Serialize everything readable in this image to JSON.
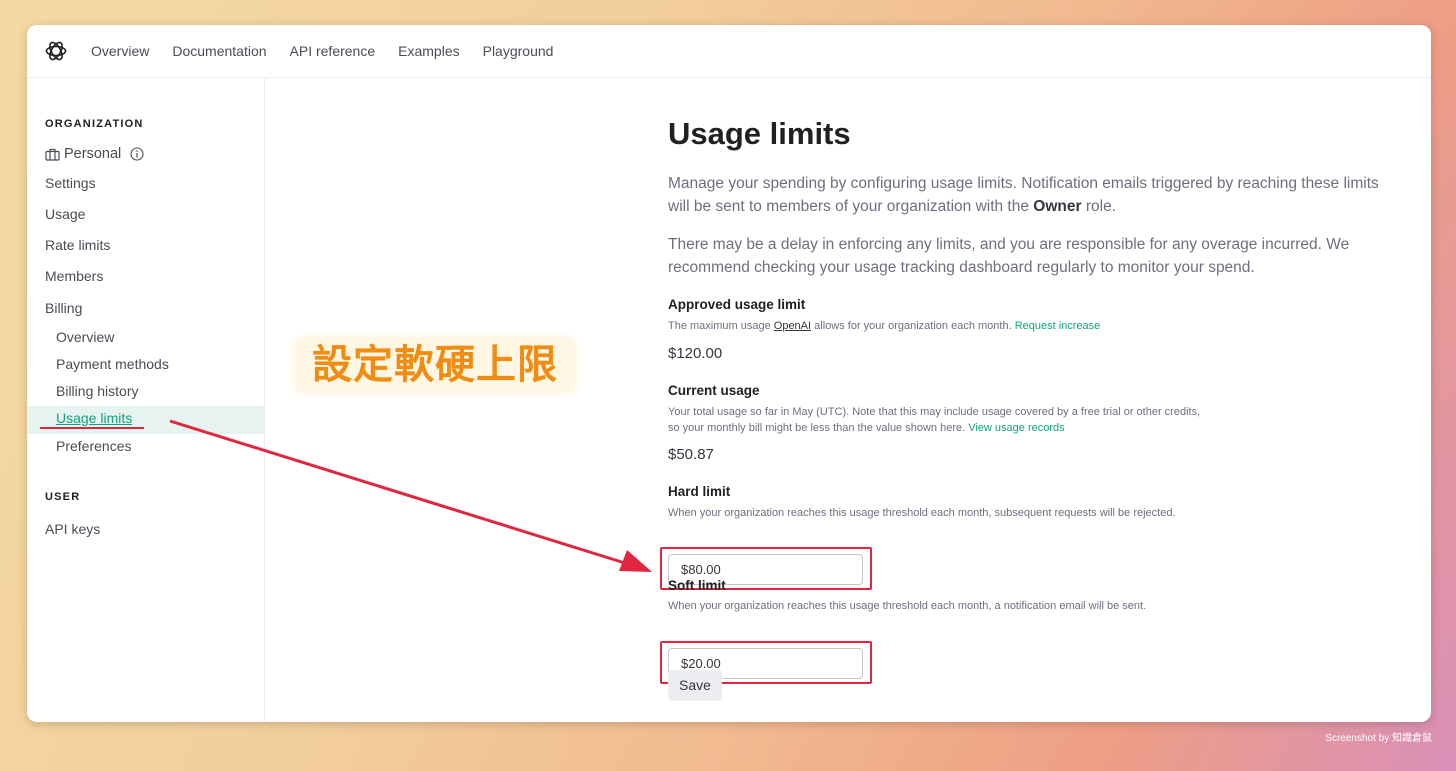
{
  "colors": {
    "accent": "#10a37f",
    "annotation_red": "#e2263f",
    "annotation_orange": "#f08c12"
  },
  "topnav": {
    "logo": "openai-logo-icon",
    "links": [
      "Overview",
      "Documentation",
      "API reference",
      "Examples",
      "Playground"
    ]
  },
  "sidebar": {
    "org_label": "ORGANIZATION",
    "org_name": "Personal",
    "org_icon": "briefcase-icon",
    "info_icon": "info-icon",
    "items": [
      "Settings",
      "Usage",
      "Rate limits",
      "Members",
      "Billing"
    ],
    "billing_sub": [
      "Overview",
      "Payment methods",
      "Billing history",
      "Usage limits",
      "Preferences"
    ],
    "user_label": "USER",
    "user_items": [
      "API keys"
    ]
  },
  "main": {
    "title": "Usage limits",
    "intro_1a": "Manage your spending by configuring usage limits. Notification emails triggered by reaching these limits will be sent to members of your organization with the ",
    "intro_1b": "Owner",
    "intro_1c": " role.",
    "intro_2": "There may be a delay in enforcing any limits, and you are responsible for any overage incurred. We recommend checking your usage tracking dashboard regularly to monitor your spend.",
    "approved": {
      "title": "Approved usage limit",
      "desc_a": "The maximum usage ",
      "desc_b": "OpenAI",
      "desc_c": " allows for your organization each month. ",
      "link": "Request increase",
      "value": "$120.00"
    },
    "current": {
      "title": "Current usage",
      "desc_1": "Your total usage so far in May (UTC). Note that this may include usage covered by a free trial or other credits,",
      "desc_2": "so your monthly bill might be less than the value shown here. ",
      "link": "View usage records",
      "value": "$50.87"
    },
    "hard": {
      "title": "Hard limit",
      "desc": "When your organization reaches this usage threshold each month, subsequent requests will be rejected.",
      "value": "$80.00"
    },
    "soft": {
      "title": "Soft limit",
      "desc": "When your organization reaches this usage threshold each month, a notification email will be sent.",
      "value": "$20.00"
    },
    "save_label": "Save"
  },
  "annotation": {
    "callout": "設定軟硬上限"
  },
  "credit": "Screenshot by 知識倉鼠"
}
